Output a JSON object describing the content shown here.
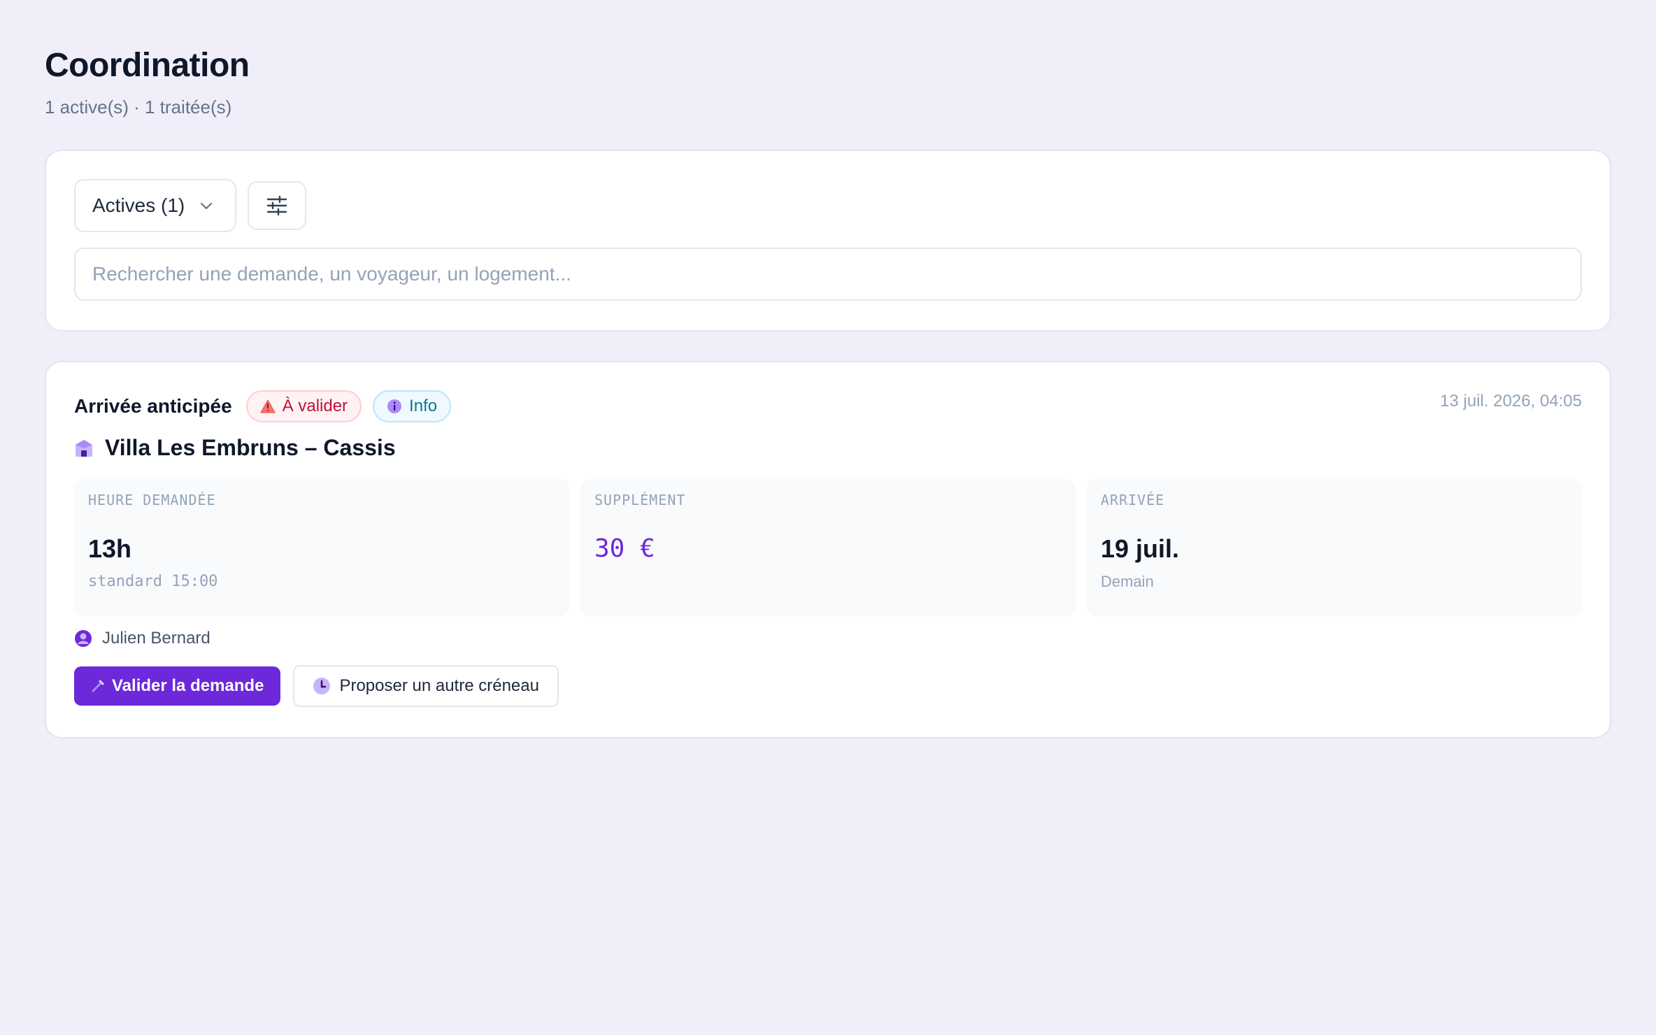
{
  "header": {
    "title": "Coordination",
    "subtitle": "1 active(s) · 1 traitée(s)"
  },
  "filters": {
    "status_dropdown": "Actives (1)",
    "filter_icon": "sliders-icon",
    "search_placeholder": "Rechercher une demande, un voyageur, un logement..."
  },
  "request": {
    "type": "Arrivée anticipée",
    "badges": [
      {
        "label": "À valider",
        "icon": "warning-icon",
        "color": "#be123c"
      },
      {
        "label": "Info",
        "icon": "info-icon",
        "color": "#0e7490"
      }
    ],
    "date": "13 juil. 2026, 04:05",
    "property": "Villa Les Embruns – Cassis",
    "property_icon": "house-icon",
    "stats": [
      {
        "label": "HEURE DEMANDÉE",
        "value": "13h",
        "sub": "standard 15:00"
      },
      {
        "label": "SUPPLÉMENT",
        "value": "30 €",
        "sub": ""
      },
      {
        "label": "ARRIVÉE",
        "value": "19 juil.",
        "sub": "Demain"
      }
    ],
    "guest": "Julien Bernard",
    "guest_icon": "user-icon",
    "actions": {
      "primary": "Valider la demande",
      "secondary": "Proposer un autre créneau"
    }
  },
  "colors": {
    "accent": "#6d28d9",
    "background": "#f0eef8"
  }
}
